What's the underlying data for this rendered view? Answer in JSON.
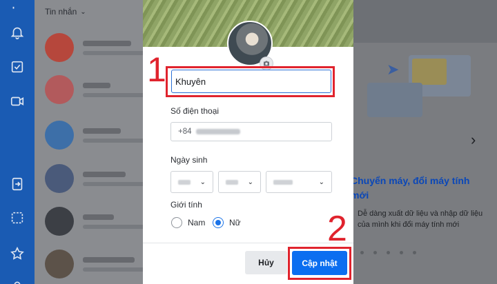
{
  "conversations": {
    "header_label": "Tin nhắn",
    "rows": [
      {
        "avatar_color": "#b6473c"
      },
      {
        "avatar_color": "#b25a5c"
      },
      {
        "avatar_color": "#3d6fa8"
      },
      {
        "avatar_color": "#4a5a7a"
      },
      {
        "avatar_color": "#3c3f45"
      },
      {
        "avatar_color": "#5c5249"
      },
      {
        "avatar_color": "#6a5d54"
      }
    ]
  },
  "nav": {
    "icons": [
      "bell-icon",
      "checkbox-icon",
      "video-icon",
      "export-icon",
      "select-icon",
      "star-icon"
    ]
  },
  "welcome": {
    "title": "Chuyển máy, đổi máy tính mới",
    "description": "Dễ dàng xuất dữ liệu và nhập dữ liệu của mình khi đổi máy tính mới"
  },
  "profile_form": {
    "name_value": "Khuyên",
    "name_callout": "1",
    "phone_label": "Số điện thoại",
    "phone_prefix": "+84",
    "birthday_label": "Ngày sinh",
    "gender_label": "Giới tính",
    "gender_options": [
      "Nam",
      "Nữ"
    ],
    "gender_selected": "Nữ",
    "cancel_label": "Hủy",
    "update_label": "Cập nhật",
    "update_callout": "2"
  },
  "colors": {
    "accent": "#0b6ef0",
    "highlight": "#e0232d",
    "welcome_title": "#0a47b8"
  }
}
